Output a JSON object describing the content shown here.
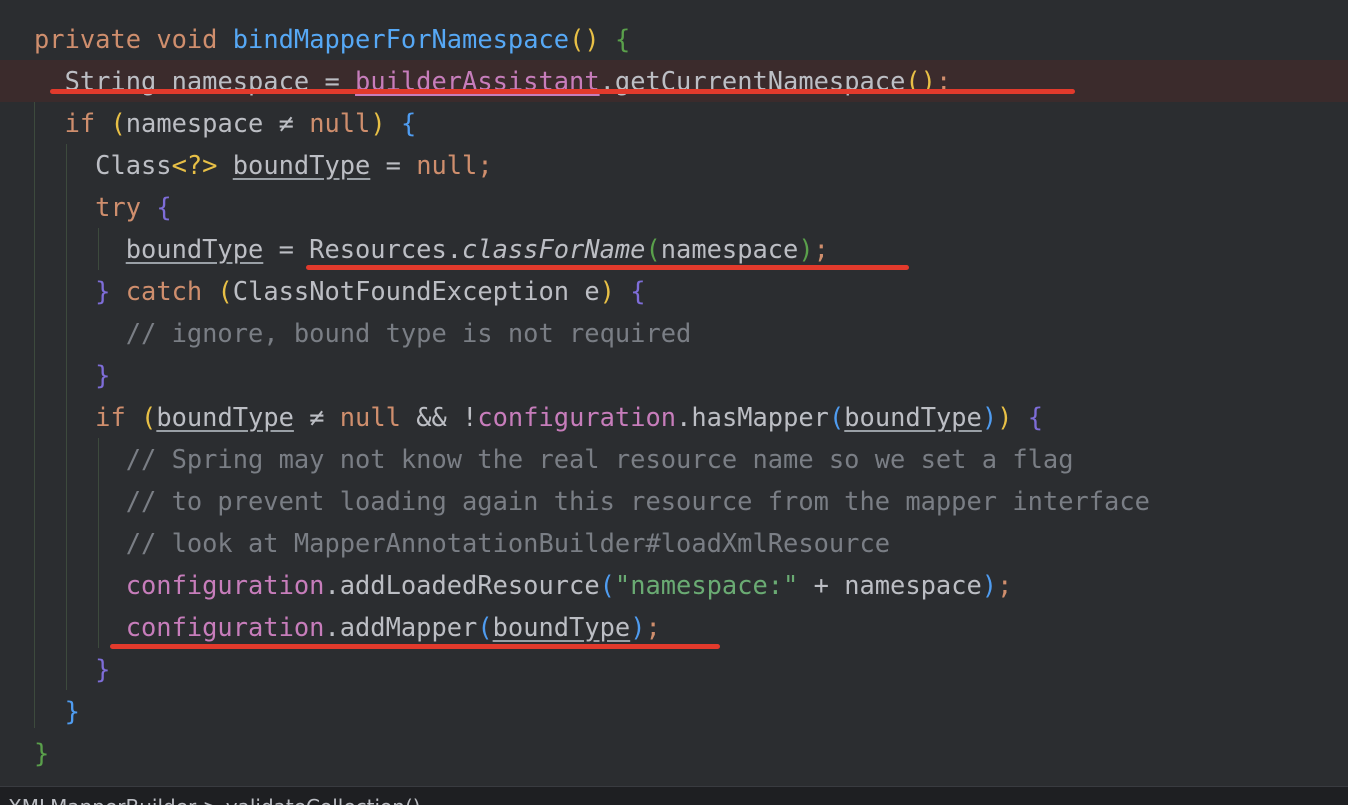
{
  "editor": {
    "lines": [
      {
        "indent": "",
        "tokens": [
          {
            "t": "private",
            "c": "kw"
          },
          {
            "t": " ",
            "c": "var"
          },
          {
            "t": "void",
            "c": "kw"
          },
          {
            "t": " ",
            "c": "var"
          },
          {
            "t": "bindMapperForNamespace",
            "c": "fn"
          },
          {
            "t": "()",
            "c": "b-yellow"
          },
          {
            "t": " ",
            "c": "var"
          },
          {
            "t": "{",
            "c": "b-green"
          }
        ]
      },
      {
        "indent": "  ",
        "highlight": true,
        "tokens": [
          {
            "t": "String",
            "c": "var"
          },
          {
            "t": " ",
            "c": "var"
          },
          {
            "t": "namespace",
            "c": "var"
          },
          {
            "t": " = ",
            "c": "var"
          },
          {
            "t": "builderAssistant",
            "c": "field-ul"
          },
          {
            "t": ".getCurrentNamespace",
            "c": "var"
          },
          {
            "t": "()",
            "c": "b-yellow"
          },
          {
            "t": ";",
            "c": "semi"
          }
        ]
      },
      {
        "indent": "  ",
        "tokens": [
          {
            "t": "if",
            "c": "kw"
          },
          {
            "t": " ",
            "c": "var"
          },
          {
            "t": "(",
            "c": "b-yellow"
          },
          {
            "t": "namespace",
            "c": "var"
          },
          {
            "t": " ≠ ",
            "c": "var"
          },
          {
            "t": "null",
            "c": "kw"
          },
          {
            "t": ")",
            "c": "b-yellow"
          },
          {
            "t": " ",
            "c": "var"
          },
          {
            "t": "{",
            "c": "b-blue"
          }
        ]
      },
      {
        "indent": "    ",
        "tokens": [
          {
            "t": "Class",
            "c": "var"
          },
          {
            "t": "<?>",
            "c": "b-yellow"
          },
          {
            "t": " ",
            "c": "var"
          },
          {
            "t": "boundType",
            "c": "ul"
          },
          {
            "t": " = ",
            "c": "var"
          },
          {
            "t": "null",
            "c": "kw"
          },
          {
            "t": ";",
            "c": "semi"
          }
        ]
      },
      {
        "indent": "    ",
        "tokens": [
          {
            "t": "try",
            "c": "kw"
          },
          {
            "t": " ",
            "c": "var"
          },
          {
            "t": "{",
            "c": "b-purple"
          }
        ]
      },
      {
        "indent": "      ",
        "tokens": [
          {
            "t": "boundType",
            "c": "ul"
          },
          {
            "t": " = ",
            "c": "var"
          },
          {
            "t": "Resources.",
            "c": "var"
          },
          {
            "t": "classForName",
            "c": "static"
          },
          {
            "t": "(",
            "c": "b-green"
          },
          {
            "t": "namespace",
            "c": "var"
          },
          {
            "t": ")",
            "c": "b-green"
          },
          {
            "t": ";",
            "c": "semi"
          }
        ]
      },
      {
        "indent": "    ",
        "tokens": [
          {
            "t": "}",
            "c": "b-purple"
          },
          {
            "t": " ",
            "c": "var"
          },
          {
            "t": "catch",
            "c": "kw"
          },
          {
            "t": " ",
            "c": "var"
          },
          {
            "t": "(",
            "c": "b-yellow"
          },
          {
            "t": "ClassNotFoundException e",
            "c": "var"
          },
          {
            "t": ")",
            "c": "b-yellow"
          },
          {
            "t": " ",
            "c": "var"
          },
          {
            "t": "{",
            "c": "b-purple"
          }
        ]
      },
      {
        "indent": "      ",
        "tokens": [
          {
            "t": "// ignore, bound type is not required",
            "c": "cmt"
          }
        ]
      },
      {
        "indent": "    ",
        "tokens": [
          {
            "t": "}",
            "c": "b-purple"
          }
        ]
      },
      {
        "indent": "    ",
        "tokens": [
          {
            "t": "if",
            "c": "kw"
          },
          {
            "t": " ",
            "c": "var"
          },
          {
            "t": "(",
            "c": "b-yellow"
          },
          {
            "t": "boundType",
            "c": "ul"
          },
          {
            "t": " ≠ ",
            "c": "var"
          },
          {
            "t": "null",
            "c": "kw"
          },
          {
            "t": " && !",
            "c": "var"
          },
          {
            "t": "configuration",
            "c": "field"
          },
          {
            "t": ".hasMapper",
            "c": "var"
          },
          {
            "t": "(",
            "c": "b-blue"
          },
          {
            "t": "boundType",
            "c": "ul"
          },
          {
            "t": ")",
            "c": "b-blue"
          },
          {
            "t": ")",
            "c": "b-yellow"
          },
          {
            "t": " ",
            "c": "var"
          },
          {
            "t": "{",
            "c": "b-purple"
          }
        ]
      },
      {
        "indent": "      ",
        "tokens": [
          {
            "t": "// Spring may not know the real resource name so we set a flag",
            "c": "cmt"
          }
        ]
      },
      {
        "indent": "      ",
        "tokens": [
          {
            "t": "// to prevent loading again this resource from the mapper interface",
            "c": "cmt"
          }
        ]
      },
      {
        "indent": "      ",
        "tokens": [
          {
            "t": "// look at MapperAnnotationBuilder#loadXmlResource",
            "c": "cmt"
          }
        ]
      },
      {
        "indent": "      ",
        "tokens": [
          {
            "t": "configuration",
            "c": "field"
          },
          {
            "t": ".addLoadedResource",
            "c": "var"
          },
          {
            "t": "(",
            "c": "b-blue"
          },
          {
            "t": "\"namespace:\"",
            "c": "str"
          },
          {
            "t": " + namespace",
            "c": "var"
          },
          {
            "t": ")",
            "c": "b-blue"
          },
          {
            "t": ";",
            "c": "semi"
          }
        ]
      },
      {
        "indent": "      ",
        "tokens": [
          {
            "t": "configuration",
            "c": "field"
          },
          {
            "t": ".addMapper",
            "c": "var"
          },
          {
            "t": "(",
            "c": "b-blue"
          },
          {
            "t": "boundType",
            "c": "ul"
          },
          {
            "t": ")",
            "c": "b-blue"
          },
          {
            "t": ";",
            "c": "semi"
          }
        ]
      },
      {
        "indent": "    ",
        "tokens": [
          {
            "t": "}",
            "c": "b-purple"
          }
        ]
      },
      {
        "indent": "  ",
        "tokens": [
          {
            "t": "}",
            "c": "b-blue"
          }
        ]
      },
      {
        "indent": "",
        "tokens": [
          {
            "t": "}",
            "c": "b-green"
          }
        ]
      }
    ]
  },
  "status": {
    "text": "XMLMapperBuilder > validateCollection()"
  },
  "colors": {
    "background": "#2b2d30",
    "keyword": "#cf8e6d",
    "method": "#56a8f5",
    "field": "#c77dbb",
    "comment": "#7a7e85",
    "string": "#6aab73",
    "annotation_underline": "#e23a2c"
  }
}
